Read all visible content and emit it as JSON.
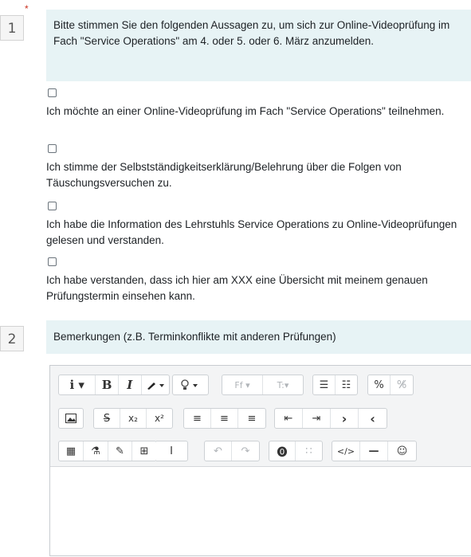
{
  "questions": [
    {
      "number": "1",
      "required_marker": "*",
      "text": "Bitte stimmen Sie den folgenden Aussagen zu, um sich zur Online-Videoprüfung im Fach \"Service Operations\" am 4. oder 5. oder 6. März anzumelden.",
      "options": [
        {
          "label": "Ich möchte an einer Online-Videoprüfung im Fach \"Service Operations\" teilnehmen.",
          "checked": false
        },
        {
          "label": "Ich stimme der Selbstständigkeitserklärung/Belehrung über die Folgen von Täuschungsversuchen zu.",
          "checked": false
        },
        {
          "label": "Ich habe die Information des Lehrstuhls Service Operations zu Online-Videoprüfungen gelesen und verstanden.",
          "checked": false
        },
        {
          "label": "Ich habe verstanden, dass ich hier am XXX eine Übersicht mit meinem genauen Prüfungstermin einsehen kann.",
          "checked": false
        }
      ]
    },
    {
      "number": "2",
      "text": "Bemerkungen (z.B. Terminkonflikte mit anderen Prüfungen)",
      "editor_value": ""
    }
  ],
  "toolbar": {
    "row1": {
      "info": "i ▾",
      "bold": "B",
      "italic": "I",
      "font_color": "🖌▾",
      "background_color": "♡▾",
      "font_family": "Ff ▾",
      "font_size": "T:▾",
      "unordered_list": "☰",
      "ordered_list": "☷",
      "link": "%",
      "unlink": "%̸"
    },
    "row2": {
      "image": "▣",
      "strikethrough": "S",
      "subscript": "x₂",
      "superscript": "x²",
      "align_left": "≡",
      "align_center": "≡",
      "align_right": "≡",
      "outdent": "⇤",
      "indent": "⇥",
      "ltr": "›",
      "rtl": "‹"
    },
    "row3": {
      "calculator": "▦",
      "chemistry": "⚗",
      "edit": "✎",
      "table": "⊞",
      "cursor": "Ⅰ",
      "undo": "↶",
      "redo": "↷",
      "accessibility": "⓿",
      "special_chars": "∷",
      "html": "</>",
      "horizontal_rule": "—",
      "emoji": "☺"
    }
  },
  "colors": {
    "question_bg": "#e7f3f5",
    "required": "#ca3120"
  }
}
